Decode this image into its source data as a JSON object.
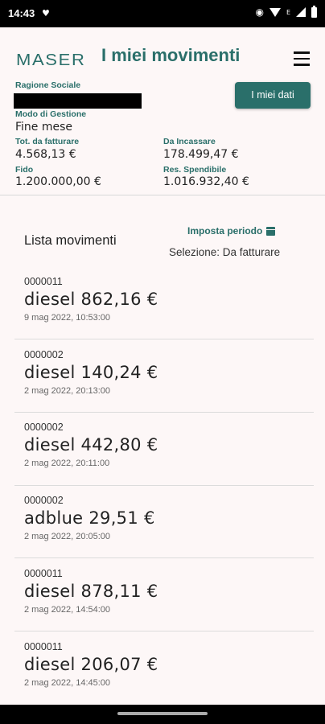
{
  "status_bar": {
    "time": "14:43",
    "left_icon": "heart-icon",
    "right_icons": [
      "eye-icon",
      "wifi-icon",
      "signal-icon",
      "battery-icon"
    ],
    "network_indicator": "E"
  },
  "header": {
    "logo": "MASER",
    "title": "I miei movimenti",
    "menu_icon": "hamburger-menu-icon",
    "my_data_button": "I miei dati"
  },
  "account": {
    "ragione_sociale_label": "Ragione Sociale",
    "modo_gestione_label": "Modo di Gestione",
    "modo_gestione_value": "Fine mese",
    "tot_fatturare_label": "Tot. da fatturare",
    "tot_fatturare_value": "4.568,13 €",
    "da_incassare_label": "Da Incassare",
    "da_incassare_value": "178.499,47 €",
    "fido_label": "Fido",
    "fido_value": "1.200.000,00 €",
    "res_spendibile_label": "Res. Spendibile",
    "res_spendibile_value": "1.016.932,40 €"
  },
  "list": {
    "title": "Lista movimenti",
    "period_button": "Imposta periodo",
    "period_icon": "calendar-icon",
    "selection": "Selezione: Da fatturare",
    "items": [
      {
        "code": "0000011",
        "main": "diesel 862,16 €",
        "date": "9 mag 2022, 10:53:00"
      },
      {
        "code": "0000002",
        "main": "diesel 140,24 €",
        "date": "2 mag 2022, 20:13:00"
      },
      {
        "code": "0000002",
        "main": "diesel 442,80 €",
        "date": "2 mag 2022, 20:11:00"
      },
      {
        "code": "0000002",
        "main": "adblue 29,51 €",
        "date": "2 mag 2022, 20:05:00"
      },
      {
        "code": "0000011",
        "main": "diesel 878,11 €",
        "date": "2 mag 2022, 14:54:00"
      },
      {
        "code": "0000011",
        "main": "diesel 206,07 €",
        "date": "2 mag 2022, 14:45:00"
      }
    ]
  },
  "colors": {
    "accent": "#2a6f6a",
    "background": "#fdf7f7",
    "statusbar": "#000000"
  }
}
